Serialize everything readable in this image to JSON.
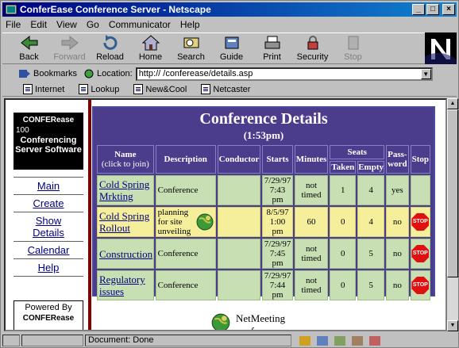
{
  "window": {
    "title": "ConferEase Conference Server - Netscape",
    "btn_min": "_",
    "btn_max": "□",
    "btn_close": "×"
  },
  "menu": [
    "File",
    "Edit",
    "View",
    "Go",
    "Communicator",
    "Help"
  ],
  "toolbar": [
    {
      "label": "Back",
      "icon": "back-arrow-icon",
      "enabled": true
    },
    {
      "label": "Forward",
      "icon": "forward-arrow-icon",
      "enabled": false
    },
    {
      "label": "Reload",
      "icon": "reload-icon",
      "enabled": true
    },
    {
      "label": "Home",
      "icon": "home-icon",
      "enabled": true
    },
    {
      "label": "Search",
      "icon": "search-icon",
      "enabled": true
    },
    {
      "label": "Guide",
      "icon": "guide-icon",
      "enabled": true
    },
    {
      "label": "Print",
      "icon": "print-icon",
      "enabled": true
    },
    {
      "label": "Security",
      "icon": "security-lock-icon",
      "enabled": true
    },
    {
      "label": "Stop",
      "icon": "stop-icon",
      "enabled": false
    }
  ],
  "location": {
    "bookmarks_label": "Bookmarks",
    "label": "Location:",
    "url": "http://  /conferease/details.asp"
  },
  "personal_bar": [
    "Internet",
    "Lookup",
    "New&Cool",
    "Netcaster"
  ],
  "sidebar": {
    "logo_brand": "CONFERease",
    "logo_num": "100",
    "logo_sub": "Conferencing Server Software",
    "links": [
      "Main",
      "Create",
      "Show Details",
      "Calendar",
      "Help"
    ],
    "powered_by": "Powered By",
    "powered_brand": "CONFERease"
  },
  "details": {
    "title": "Conference Details",
    "time": "(1:53pm)",
    "headers": {
      "name": "Name",
      "name_sub": "(click to join)",
      "description": "Description",
      "conductor": "Conductor",
      "starts": "Starts",
      "minutes": "Minutes",
      "seats": "Seats",
      "taken": "Taken",
      "empty": "Empty",
      "password": "Pass-word",
      "stop": "Stop"
    },
    "rows": [
      {
        "name": "Cold Spring Mrkting",
        "description": "Conference",
        "conductor": "",
        "date": "7/29/97",
        "time": "7:43 pm",
        "minutes": "not timed",
        "taken": "1",
        "empty": "4",
        "password": "yes",
        "stop": ""
      },
      {
        "name": "Cold Spring Rollout",
        "description": "planning for site unveiling",
        "conductor": "",
        "date": "8/5/97",
        "time": "1:00 pm",
        "minutes": "60",
        "taken": "0",
        "empty": "4",
        "password": "no",
        "stop": "STOP"
      },
      {
        "name": "Construction",
        "description": "Conference",
        "conductor": "",
        "date": "7/29/97",
        "time": "7:45 pm",
        "minutes": "not timed",
        "taken": "0",
        "empty": "5",
        "password": "no",
        "stop": "STOP"
      },
      {
        "name": "Regulatory issues",
        "description": "Conference",
        "conductor": "",
        "date": "7/29/97",
        "time": "7:44 pm",
        "minutes": "not timed",
        "taken": "0",
        "empty": "5",
        "password": "no",
        "stop": "STOP"
      }
    ]
  },
  "netmeeting": {
    "line1": "NetMeeting",
    "line2": "conference"
  },
  "status": {
    "text": "Document: Done"
  }
}
